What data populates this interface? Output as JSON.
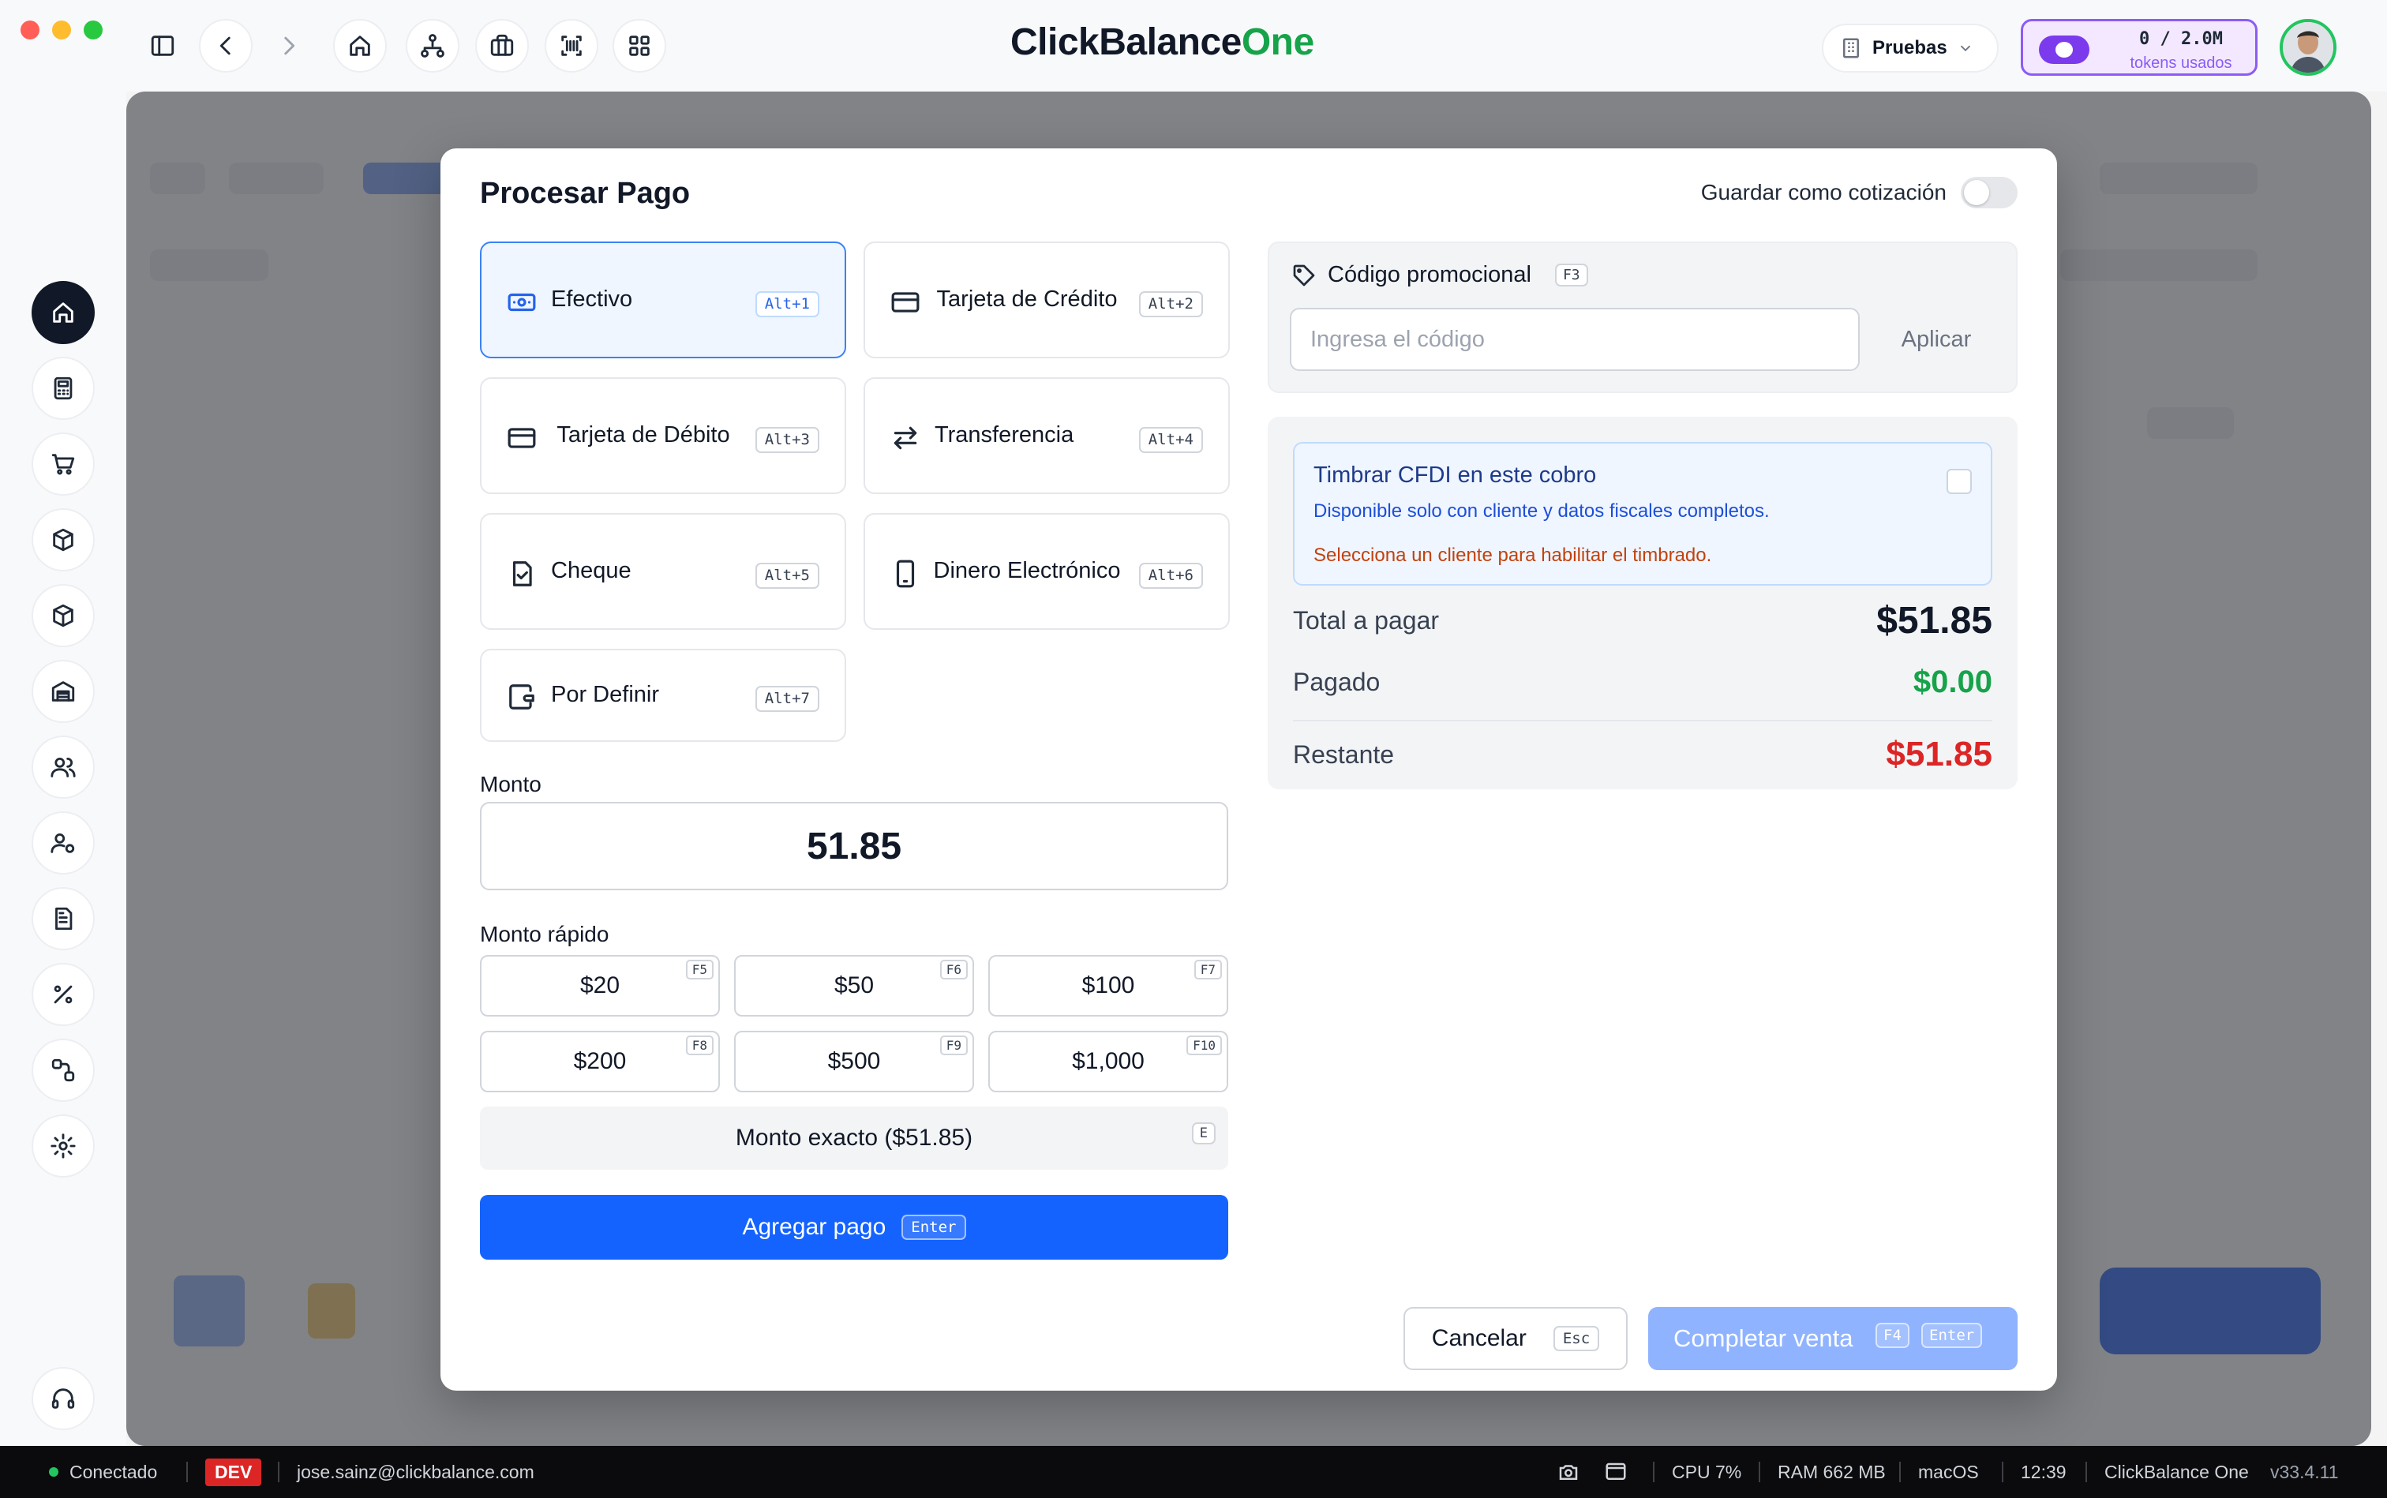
{
  "app": {
    "brand_main": "ClickBalance",
    "brand_accent": "One"
  },
  "header": {
    "environment": "Pruebas",
    "tokens": {
      "count": "0 / 2.0M",
      "label": "tokens usados"
    }
  },
  "icons": {
    "toolbar": [
      "sidebar-toggle-icon",
      "back-icon",
      "forward-icon",
      "home-icon",
      "org-chart-icon",
      "briefcase-icon",
      "barcode-scan-icon",
      "grid-icon"
    ],
    "sidebar": [
      "home-icon",
      "calculator-icon",
      "cart-icon",
      "box-edit-icon",
      "box-icon",
      "warehouse-icon",
      "users-icon",
      "user-settings-icon",
      "document-icon",
      "percent-icon",
      "workflow-icon",
      "gear-icon",
      "headset-icon"
    ]
  },
  "modal": {
    "title": "Procesar Pago",
    "save_quote_label": "Guardar como cotización",
    "payment_methods": [
      {
        "label": "Efectivo",
        "shortcut": "Alt+1",
        "icon": "cash-icon",
        "selected": true
      },
      {
        "label": "Tarjeta de Crédito",
        "shortcut": "Alt+2",
        "icon": "credit-card-icon",
        "selected": false
      },
      {
        "label": "Tarjeta de Débito",
        "shortcut": "Alt+3",
        "icon": "debit-card-icon",
        "selected": false
      },
      {
        "label": "Transferencia",
        "shortcut": "Alt+4",
        "icon": "transfer-icon",
        "selected": false
      },
      {
        "label": "Cheque",
        "shortcut": "Alt+5",
        "icon": "check-document-icon",
        "selected": false
      },
      {
        "label": "Dinero Electrónico",
        "shortcut": "Alt+6",
        "icon": "phone-icon",
        "selected": false
      },
      {
        "label": "Por Definir",
        "shortcut": "Alt+7",
        "icon": "wallet-icon",
        "selected": false
      }
    ],
    "amount_label": "Monto",
    "amount_value": "51.85",
    "quick_label": "Monto rápido",
    "quick_amounts": [
      {
        "label": "$20",
        "key": "F5"
      },
      {
        "label": "$50",
        "key": "F6"
      },
      {
        "label": "$100",
        "key": "F7"
      },
      {
        "label": "$200",
        "key": "F8"
      },
      {
        "label": "$500",
        "key": "F9"
      },
      {
        "label": "$1,000",
        "key": "F10"
      }
    ],
    "exact": {
      "label": "Monto exacto ($51.85)",
      "key": "E"
    },
    "add_payment": {
      "label": "Agregar pago",
      "key": "Enter"
    },
    "promo": {
      "title": "Código promocional",
      "key": "F3",
      "placeholder": "Ingresa el código",
      "apply_label": "Aplicar"
    },
    "cfdi": {
      "title": "Timbrar CFDI en este cobro",
      "subtitle": "Disponible solo con cliente y datos fiscales completos.",
      "warning": "Selecciona un cliente para habilitar el timbrado."
    },
    "totals": {
      "total_label": "Total a pagar",
      "total_value": "$51.85",
      "paid_label": "Pagado",
      "paid_value": "$0.00",
      "remaining_label": "Restante",
      "remaining_value": "$51.85"
    },
    "cancel": {
      "label": "Cancelar",
      "key": "Esc"
    },
    "complete": {
      "label": "Completar venta",
      "key1": "F4",
      "key2": "Enter"
    }
  },
  "status_bar": {
    "connection": "Conectado",
    "env_badge": "DEV",
    "user_email": "jose.sainz@clickbalance.com",
    "cpu": "CPU 7%",
    "ram": "RAM 662 MB",
    "os": "macOS",
    "time": "12:39",
    "app_name": "ClickBalance One",
    "version": "v33.4.11"
  },
  "colors": {
    "primary": "#1463ff",
    "accent_green": "#16a34a",
    "danger": "#dc2626",
    "purple": "#7c3aed",
    "warning": "#c2410c"
  }
}
